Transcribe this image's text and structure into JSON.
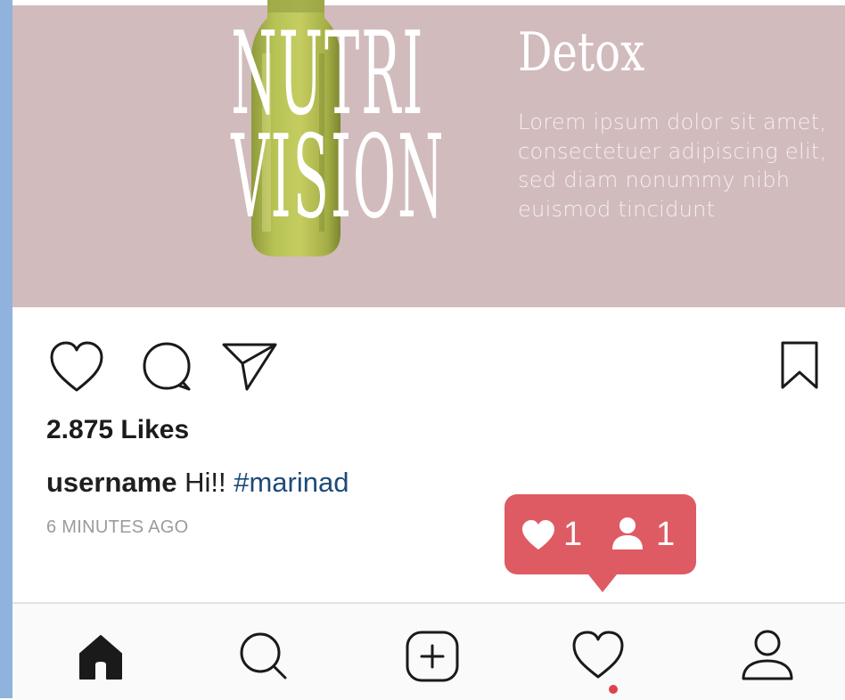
{
  "post": {
    "brand_line1": "NUTRI",
    "brand_line2": "VISION",
    "product_title": "Detox",
    "description": "Lorem ipsum dolor sit amet, consectetuer adipiscing elit, sed diam nonummy nibh euismod tincidunt"
  },
  "actions": {
    "like_icon": "heart-outline-icon",
    "comment_icon": "comment-bubble-icon",
    "share_icon": "paper-plane-icon",
    "save_icon": "bookmark-icon"
  },
  "likes_text": "2.875 Likes",
  "caption": {
    "username": "username",
    "text": "Hi!!",
    "hashtag": "#marinad"
  },
  "timestamp": "6 MINUTES AGO",
  "notification": {
    "likes_count": "1",
    "followers_count": "1",
    "color": "#de5b63"
  },
  "bottom_nav": {
    "items": [
      "home-icon",
      "search-icon",
      "add-post-icon",
      "activity-heart-icon",
      "profile-icon"
    ],
    "active_item": "home-icon"
  },
  "colors": {
    "post_background": "#d1bbbd",
    "hashtag": "#1e4a7a",
    "accent": "#de5b63"
  }
}
